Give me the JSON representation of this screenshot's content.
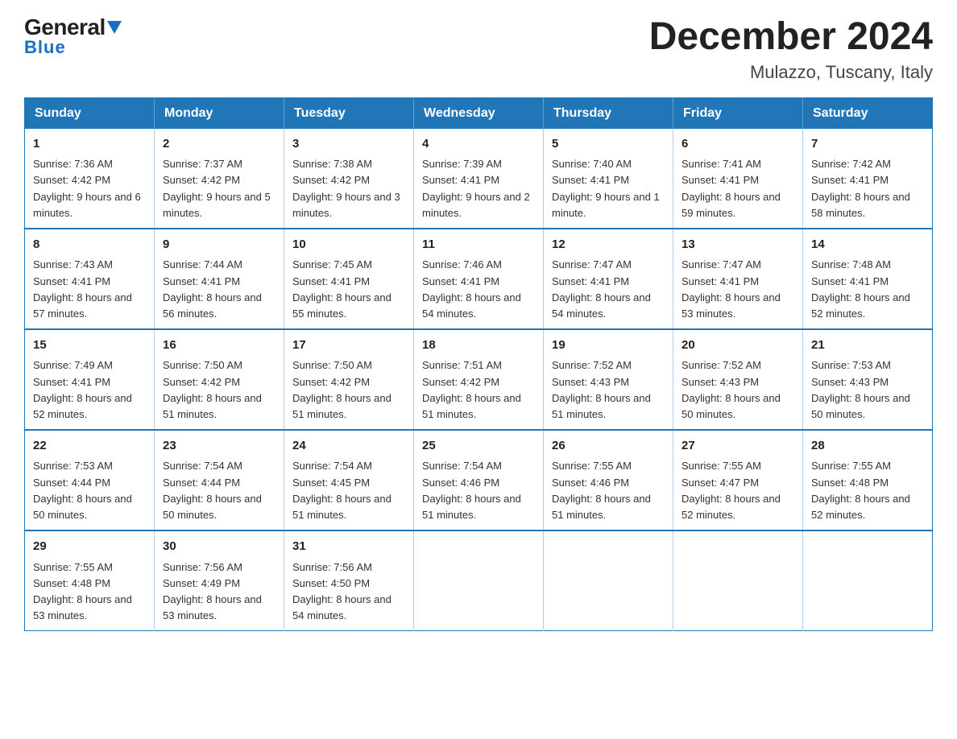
{
  "logo": {
    "text_general": "General",
    "text_blue": "Blue"
  },
  "header": {
    "title": "December 2024",
    "subtitle": "Mulazzo, Tuscany, Italy"
  },
  "columns": [
    "Sunday",
    "Monday",
    "Tuesday",
    "Wednesday",
    "Thursday",
    "Friday",
    "Saturday"
  ],
  "weeks": [
    [
      {
        "day": "1",
        "sunrise": "7:36 AM",
        "sunset": "4:42 PM",
        "daylight": "9 hours and 6 minutes."
      },
      {
        "day": "2",
        "sunrise": "7:37 AM",
        "sunset": "4:42 PM",
        "daylight": "9 hours and 5 minutes."
      },
      {
        "day": "3",
        "sunrise": "7:38 AM",
        "sunset": "4:42 PM",
        "daylight": "9 hours and 3 minutes."
      },
      {
        "day": "4",
        "sunrise": "7:39 AM",
        "sunset": "4:41 PM",
        "daylight": "9 hours and 2 minutes."
      },
      {
        "day": "5",
        "sunrise": "7:40 AM",
        "sunset": "4:41 PM",
        "daylight": "9 hours and 1 minute."
      },
      {
        "day": "6",
        "sunrise": "7:41 AM",
        "sunset": "4:41 PM",
        "daylight": "8 hours and 59 minutes."
      },
      {
        "day": "7",
        "sunrise": "7:42 AM",
        "sunset": "4:41 PM",
        "daylight": "8 hours and 58 minutes."
      }
    ],
    [
      {
        "day": "8",
        "sunrise": "7:43 AM",
        "sunset": "4:41 PM",
        "daylight": "8 hours and 57 minutes."
      },
      {
        "day": "9",
        "sunrise": "7:44 AM",
        "sunset": "4:41 PM",
        "daylight": "8 hours and 56 minutes."
      },
      {
        "day": "10",
        "sunrise": "7:45 AM",
        "sunset": "4:41 PM",
        "daylight": "8 hours and 55 minutes."
      },
      {
        "day": "11",
        "sunrise": "7:46 AM",
        "sunset": "4:41 PM",
        "daylight": "8 hours and 54 minutes."
      },
      {
        "day": "12",
        "sunrise": "7:47 AM",
        "sunset": "4:41 PM",
        "daylight": "8 hours and 54 minutes."
      },
      {
        "day": "13",
        "sunrise": "7:47 AM",
        "sunset": "4:41 PM",
        "daylight": "8 hours and 53 minutes."
      },
      {
        "day": "14",
        "sunrise": "7:48 AM",
        "sunset": "4:41 PM",
        "daylight": "8 hours and 52 minutes."
      }
    ],
    [
      {
        "day": "15",
        "sunrise": "7:49 AM",
        "sunset": "4:41 PM",
        "daylight": "8 hours and 52 minutes."
      },
      {
        "day": "16",
        "sunrise": "7:50 AM",
        "sunset": "4:42 PM",
        "daylight": "8 hours and 51 minutes."
      },
      {
        "day": "17",
        "sunrise": "7:50 AM",
        "sunset": "4:42 PM",
        "daylight": "8 hours and 51 minutes."
      },
      {
        "day": "18",
        "sunrise": "7:51 AM",
        "sunset": "4:42 PM",
        "daylight": "8 hours and 51 minutes."
      },
      {
        "day": "19",
        "sunrise": "7:52 AM",
        "sunset": "4:43 PM",
        "daylight": "8 hours and 51 minutes."
      },
      {
        "day": "20",
        "sunrise": "7:52 AM",
        "sunset": "4:43 PM",
        "daylight": "8 hours and 50 minutes."
      },
      {
        "day": "21",
        "sunrise": "7:53 AM",
        "sunset": "4:43 PM",
        "daylight": "8 hours and 50 minutes."
      }
    ],
    [
      {
        "day": "22",
        "sunrise": "7:53 AM",
        "sunset": "4:44 PM",
        "daylight": "8 hours and 50 minutes."
      },
      {
        "day": "23",
        "sunrise": "7:54 AM",
        "sunset": "4:44 PM",
        "daylight": "8 hours and 50 minutes."
      },
      {
        "day": "24",
        "sunrise": "7:54 AM",
        "sunset": "4:45 PM",
        "daylight": "8 hours and 51 minutes."
      },
      {
        "day": "25",
        "sunrise": "7:54 AM",
        "sunset": "4:46 PM",
        "daylight": "8 hours and 51 minutes."
      },
      {
        "day": "26",
        "sunrise": "7:55 AM",
        "sunset": "4:46 PM",
        "daylight": "8 hours and 51 minutes."
      },
      {
        "day": "27",
        "sunrise": "7:55 AM",
        "sunset": "4:47 PM",
        "daylight": "8 hours and 52 minutes."
      },
      {
        "day": "28",
        "sunrise": "7:55 AM",
        "sunset": "4:48 PM",
        "daylight": "8 hours and 52 minutes."
      }
    ],
    [
      {
        "day": "29",
        "sunrise": "7:55 AM",
        "sunset": "4:48 PM",
        "daylight": "8 hours and 53 minutes."
      },
      {
        "day": "30",
        "sunrise": "7:56 AM",
        "sunset": "4:49 PM",
        "daylight": "8 hours and 53 minutes."
      },
      {
        "day": "31",
        "sunrise": "7:56 AM",
        "sunset": "4:50 PM",
        "daylight": "8 hours and 54 minutes."
      },
      null,
      null,
      null,
      null
    ]
  ]
}
